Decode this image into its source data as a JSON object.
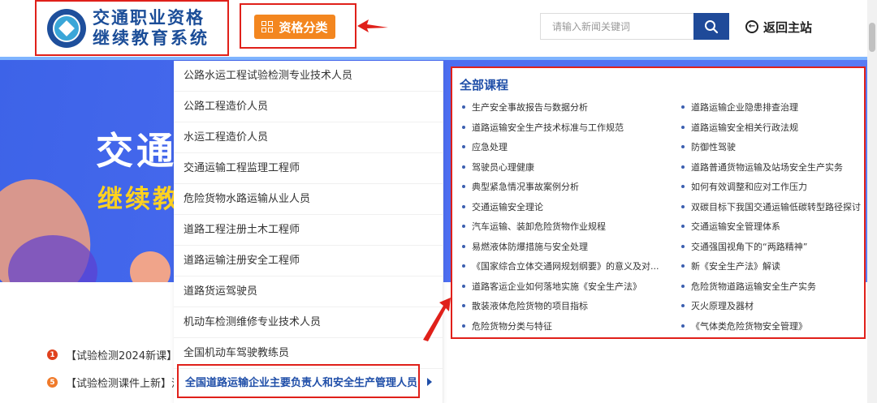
{
  "header": {
    "logo_line1": "交通职业资格",
    "logo_line2": "继续教育系统",
    "category_button": "资格分类",
    "search_placeholder": "请输入新闻关键词",
    "back_home": "返回主站"
  },
  "banner": {
    "title": "交通",
    "subtitle": "继续教"
  },
  "news": [
    {
      "num": "1",
      "text": "【试验检测2024新课】小"
    },
    {
      "num": "5",
      "text": "【试验检测课件上新】混"
    }
  ],
  "menu": {
    "items": [
      "公路水运工程试验检测专业技术人员",
      "公路工程造价人员",
      "水运工程造价人员",
      "交通运输工程监理工程师",
      "危险货物水路运输从业人员",
      "道路工程注册土木工程师",
      "道路运输注册安全工程师",
      "道路货运驾驶员",
      "机动车检测维修专业技术人员",
      "全国机动车驾驶教练员"
    ],
    "active_item": "全国道路运输企业主要负责人和安全生产管理人员"
  },
  "panel": {
    "title": "全部课程",
    "left": [
      "生产安全事故报告与数据分析",
      "道路运输安全生产技术标准与工作规范",
      "应急处理",
      "驾驶员心理健康",
      "典型紧急情况事故案例分析",
      "交通运输安全理论",
      "汽车运输、装卸危险货物作业规程",
      "易燃液体防爆措施与安全处理",
      "《国家综合立体交通网规划纲要》的意义及对...",
      "道路客运企业如何落地实施《安全生产法》",
      "散装液体危险货物的项目指标",
      "危险货物分类与特征"
    ],
    "right": [
      "道路运输企业隐患排查治理",
      "道路运输安全相关行政法规",
      "防御性驾驶",
      "道路普通货物运输及站场安全生产实务",
      "如何有效调整和应对工作压力",
      "双碳目标下我国交通运输低碳转型路径探讨",
      "交通运输安全管理体系",
      "交通强国视角下的“两路精神”",
      "新《安全生产法》解读",
      "危险货物道路运输安全生产实务",
      "灭火原理及器材",
      "《气体类危险货物安全管理》"
    ]
  },
  "colors": {
    "brand_blue": "#1f4ea8",
    "accent_orange": "#f3861f",
    "highlight_red": "#e0201a",
    "banner_blue": "#4b6cf0"
  }
}
